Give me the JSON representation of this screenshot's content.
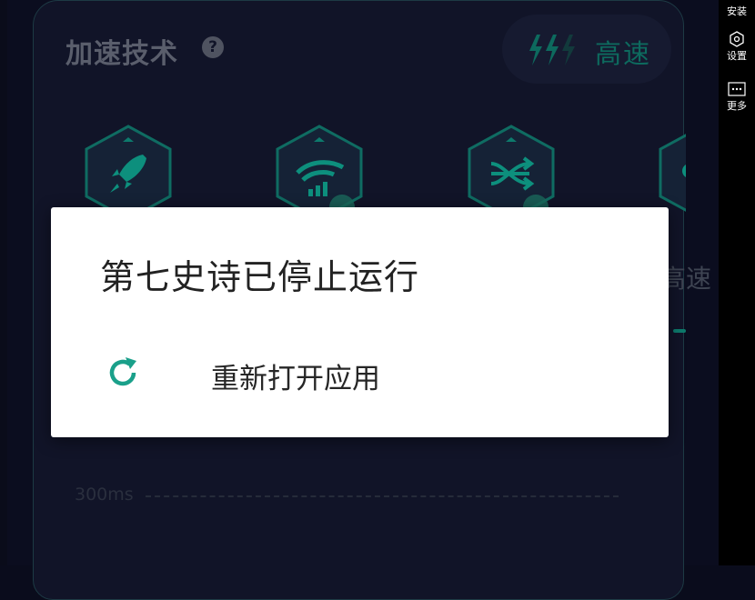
{
  "card": {
    "title": "加速技术",
    "speed_label": "高速",
    "side_text": "高速"
  },
  "latency": {
    "label": "300ms"
  },
  "dialog": {
    "title": "第七史诗已停止运行",
    "action_label": "重新打开应用"
  },
  "right_panel": {
    "install_label": "安装",
    "settings_label": "设置",
    "more_label": "更多"
  },
  "colors": {
    "accent": "#0d8f7d",
    "reload_icon": "#1aa08a",
    "dialog_bg": "#ffffff",
    "app_bg": "#0b0d1f"
  },
  "icons": [
    "help-icon",
    "lightning-icon",
    "rocket-icon",
    "wifi-signal-icon",
    "shuffle-arrows-icon",
    "reload-icon",
    "settings-icon",
    "more-icon"
  ]
}
